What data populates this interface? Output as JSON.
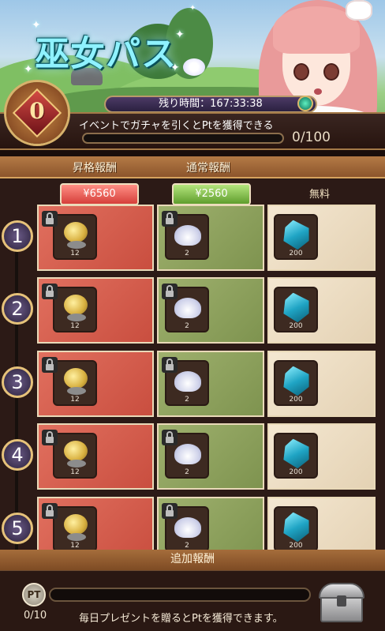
{
  "banner": {
    "title": "巫女パス",
    "remaining_time": "残り時間：167:33:38",
    "level": "0",
    "info_text": "イベントでガチャを引くとPtを獲得できる",
    "pt_progress_text": "0/100",
    "pt_progress_fraction": 0
  },
  "columns": {
    "premium_title": "昇格報酬",
    "normal_title": "通常報酬",
    "premium_price": "¥6560",
    "normal_price": "¥2560",
    "free_label": "無料"
  },
  "rows": [
    {
      "level": "1",
      "premium_qty": "12",
      "normal_qty": "2",
      "free_qty": "200"
    },
    {
      "level": "2",
      "premium_qty": "12",
      "normal_qty": "2",
      "free_qty": "200"
    },
    {
      "level": "3",
      "premium_qty": "12",
      "normal_qty": "2",
      "free_qty": "200"
    },
    {
      "level": "4",
      "premium_qty": "12",
      "normal_qty": "2",
      "free_qty": "200"
    },
    {
      "level": "5",
      "premium_qty": "12",
      "normal_qty": "2",
      "free_qty": "200"
    }
  ],
  "rewards": {
    "premium_item_icon": "gold-flower-icon",
    "normal_item_icon": "lotus-icon",
    "free_item_icon": "blue-crystal-icon",
    "locked_icon": "lock-icon"
  },
  "footer": {
    "section_title": "追加報酬",
    "badge": "PT",
    "count": "0/10",
    "progress_fraction": 0,
    "description": "毎日プレゼントを贈るとPtを獲得できます。",
    "chest_icon": "treasure-chest-icon"
  },
  "colors": {
    "premium": "#d85a4a",
    "normal": "#8ea35e",
    "free": "#efe0c6",
    "accent_gold": "#e6c27a"
  }
}
